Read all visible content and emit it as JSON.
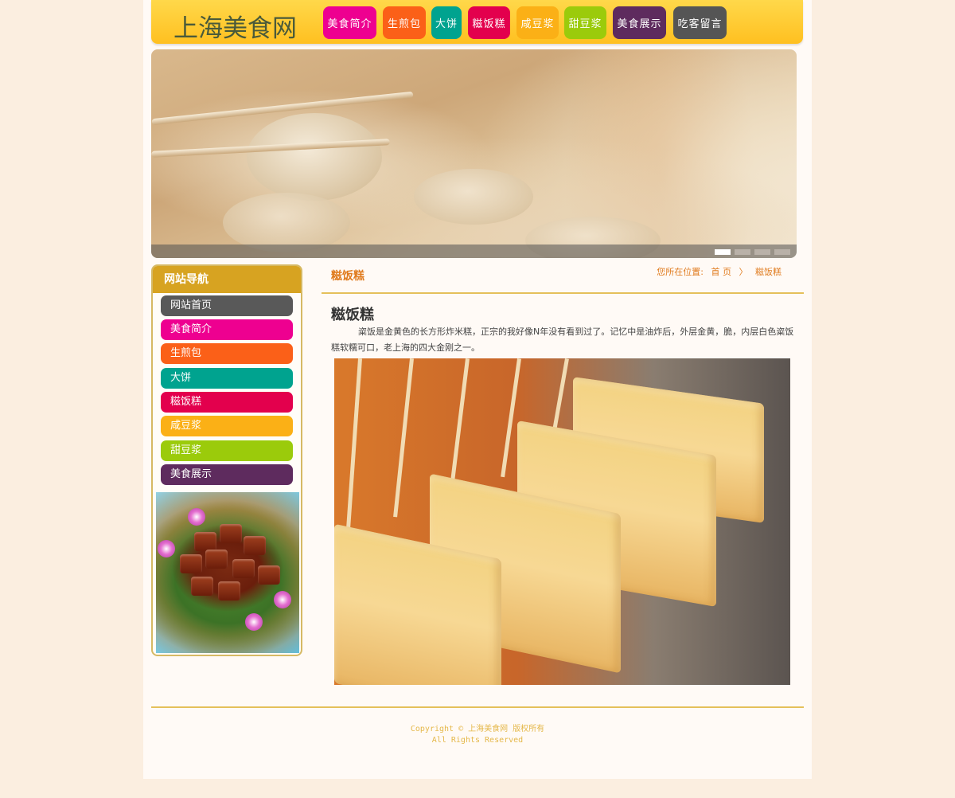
{
  "site": {
    "logo": "上海美食网"
  },
  "nav": [
    {
      "label": "美食简介",
      "color": "#ee0090"
    },
    {
      "label": "生煎包",
      "color": "#fb6018"
    },
    {
      "label": "大饼",
      "color": "#00a38f"
    },
    {
      "label": "糍饭糕",
      "color": "#e3004d"
    },
    {
      "label": "咸豆浆",
      "color": "#fbb016"
    },
    {
      "label": "甜豆浆",
      "color": "#9bcb0b"
    },
    {
      "label": "美食展示",
      "color": "#5e2b5e"
    },
    {
      "label": "吃客留言",
      "color": "#555555"
    }
  ],
  "sidebar": {
    "title": "网站导航",
    "items": [
      {
        "label": "网站首页",
        "color": "#595959"
      },
      {
        "label": "美食简介",
        "color": "#ee0090"
      },
      {
        "label": "生煎包",
        "color": "#fb6018"
      },
      {
        "label": "大饼",
        "color": "#00a38f"
      },
      {
        "label": "糍饭糕",
        "color": "#e3004d"
      },
      {
        "label": "咸豆浆",
        "color": "#fbb016"
      },
      {
        "label": "甜豆浆",
        "color": "#9bcb0b"
      },
      {
        "label": "美食展示",
        "color": "#5e2b5e"
      }
    ]
  },
  "content": {
    "section_title": "糍饭糕",
    "breadcrumb": {
      "prefix": "您所在位置:",
      "home": "首 页",
      "separator": "〉",
      "current": "糍饭糕"
    },
    "article_title": "糍饭糕",
    "article_text": "粢饭是金黄色的长方形炸米糕，正宗的我好像N年没有看到过了。记忆中是油炸后，外层金黄，脆，内层白色粢饭糕软糯可口，老上海的四大金刚之一。"
  },
  "footer": {
    "copyright": "Copyright © 上海美食网 版权所有",
    "rights": "All Rights Reserved"
  }
}
